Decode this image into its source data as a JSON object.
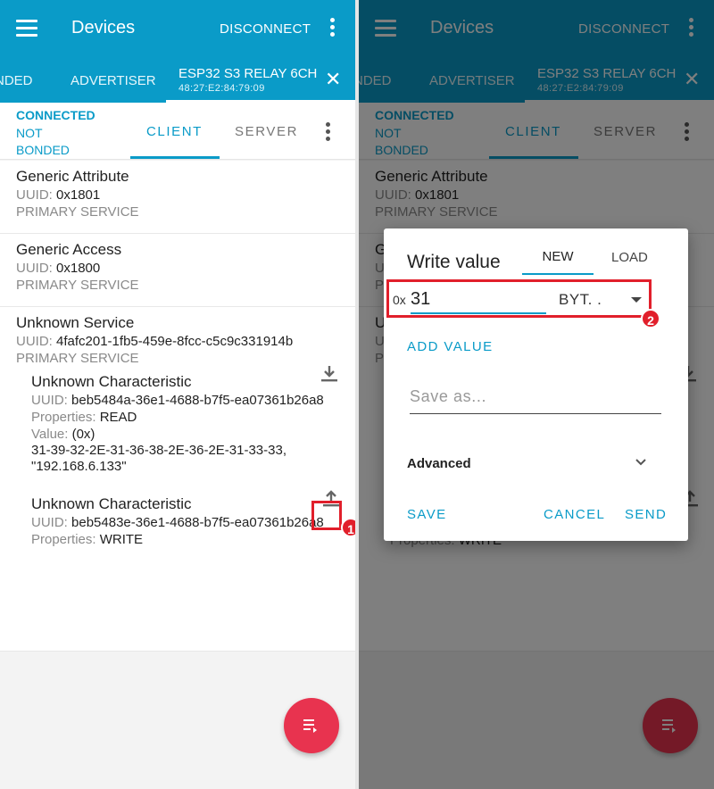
{
  "appbar": {
    "title": "Devices",
    "disconnect_label": "DISCONNECT"
  },
  "tabs": {
    "bonded_partial": "NDED",
    "advertiser": "ADVERTISER",
    "device_name": "ESP32 S3 RELAY 6CH",
    "device_mac": "48:27:E2:84:79:09"
  },
  "status": {
    "connected": "CONNECTED",
    "bond_state": "NOT BONDED"
  },
  "subtabs": {
    "client": "CLIENT",
    "server": "SERVER"
  },
  "services": [
    {
      "name": "Generic Attribute",
      "uuid_label": "UUID:",
      "uuid": "0x1801",
      "type": "PRIMARY SERVICE"
    },
    {
      "name": "Generic Access",
      "uuid_label": "UUID:",
      "uuid": "0x1800",
      "type": "PRIMARY SERVICE"
    },
    {
      "name": "Unknown Service",
      "uuid_label": "UUID:",
      "uuid": "4fafc201-1fb5-459e-8fcc-c5c9c331914b",
      "type": "PRIMARY SERVICE"
    }
  ],
  "characteristics": [
    {
      "name": "Unknown Characteristic",
      "uuid_label": "UUID:",
      "uuid": "beb5484a-36e1-4688-b7f5-ea07361b26a8",
      "props_label": "Properties:",
      "props": "READ",
      "value_label": "Value:",
      "value_fmt": "(0x)",
      "value_hex": "31-39-32-2E-31-36-38-2E-36-2E-31-33-33,",
      "value_str": "\"192.168.6.133\""
    },
    {
      "name": "Unknown Characteristic",
      "uuid_label": "UUID:",
      "uuid": "beb5483e-36e1-4688-b7f5-ea07361b26a8",
      "props_label": "Properties:",
      "props": "WRITE"
    }
  ],
  "dialog": {
    "title": "Write value",
    "tab_new": "NEW",
    "tab_load": "LOAD",
    "prefix": "0x",
    "value": "31",
    "format": "BYT. .",
    "add_value": "ADD VALUE",
    "save_as_placeholder": "Save as...",
    "advanced": "Advanced",
    "save": "SAVE",
    "cancel": "CANCEL",
    "send": "SEND"
  },
  "annotations": {
    "step1": "1",
    "step2": "2",
    "highlight_color": "#e11f2b"
  },
  "colors": {
    "primary": "#0a9bc8",
    "fab": "#e8334f"
  },
  "icons": {
    "menu": "menu-icon",
    "more": "more-vert-icon",
    "close": "close-icon",
    "read": "download-icon",
    "write": "upload-icon",
    "fab": "log-list-icon",
    "expand": "chevron-down-icon"
  }
}
